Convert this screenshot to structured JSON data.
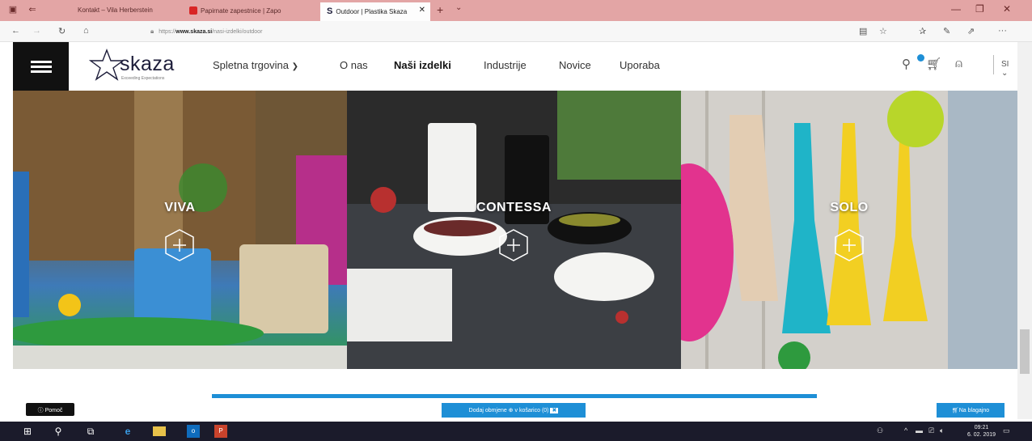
{
  "browser": {
    "tabs": [
      {
        "label": "Kontakt – Vila Herberstein",
        "active": false
      },
      {
        "label": "Papirnate zapestnice | Zapo",
        "active": false
      },
      {
        "label": "Outdoor | Plastika Skaza",
        "active": true
      }
    ],
    "url_prefix": "https://",
    "url_domain": "www.skaza.si",
    "url_path": "/nasi-izdelki/outdoor"
  },
  "site": {
    "logo_text": "skaza",
    "logo_tagline": "Exceeding Expectations",
    "menu": [
      {
        "label": "Spletna trgovina",
        "has_dropdown": true
      },
      {
        "label": "O nas"
      },
      {
        "label": "Naši izdelki",
        "active": true
      },
      {
        "label": "Industrije"
      },
      {
        "label": "Novice"
      },
      {
        "label": "Uporaba"
      }
    ],
    "language": "SI",
    "cart_badge_color": "#1e8fd6"
  },
  "panels": [
    {
      "title": "VIVA"
    },
    {
      "title": "CONTESSA"
    },
    {
      "title": "SOLO"
    }
  ],
  "bottom": {
    "help_label": "Pomoč",
    "compare_label": "Dodaj obmjene ⊕ v košarico (0)",
    "checkout_label": "Na blagajno"
  },
  "taskbar": {
    "time": "09:21",
    "date": "6. 02. 2019"
  },
  "colors": {
    "accent": "#1e8fd6",
    "tabbar": "#e3a5a5"
  }
}
